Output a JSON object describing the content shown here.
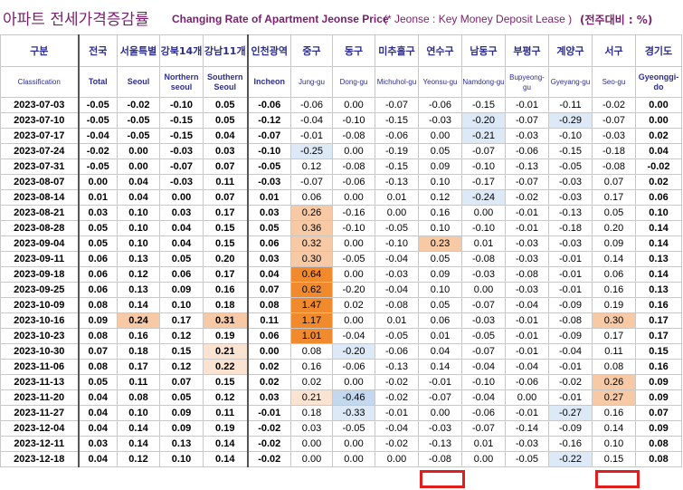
{
  "title": {
    "korean": "아파트 전세가격증감률",
    "english": "Changing Rate of Apartment Jeonse Price",
    "note": "(* Jeonse : Key Money Deposit Lease )",
    "unit": "(전주대비 : %)"
  },
  "headers": [
    {
      "kr": "구분",
      "en": "Classification"
    },
    {
      "kr": "전국",
      "en": "Total"
    },
    {
      "kr": "서울특별",
      "en": "Seoul"
    },
    {
      "kr": "강북14개",
      "en": "Northern seoul"
    },
    {
      "kr": "강남11개",
      "en": "Southern Seoul"
    },
    {
      "kr": "인천광역",
      "en": "Incheon"
    },
    {
      "kr": "중구",
      "en": "Jung-gu"
    },
    {
      "kr": "동구",
      "en": "Dong-gu"
    },
    {
      "kr": "미추홀구",
      "en": "Michuhol-gu"
    },
    {
      "kr": "연수구",
      "en": "Yeonsu-gu"
    },
    {
      "kr": "남동구",
      "en": "Namdong-gu"
    },
    {
      "kr": "부평구",
      "en": "Bupyeong-gu"
    },
    {
      "kr": "계양구",
      "en": "Gyeyang-gu"
    },
    {
      "kr": "서구",
      "en": "Seo-gu"
    },
    {
      "kr": "경기도",
      "en": "Gyeonggi-do"
    }
  ],
  "rows": [
    {
      "date": "2023-07-03",
      "values": [
        "-0.05",
        "-0.02",
        "-0.10",
        "0.05",
        "-0.06",
        "-0.06",
        "0.00",
        "-0.07",
        "-0.06",
        "-0.15",
        "-0.01",
        "-0.11",
        "-0.02",
        "0.00"
      ],
      "shade": {}
    },
    {
      "date": "2023-07-10",
      "values": [
        "-0.05",
        "-0.05",
        "-0.15",
        "0.05",
        "-0.12",
        "-0.04",
        "-0.10",
        "-0.15",
        "-0.03",
        "-0.20",
        "-0.07",
        "-0.29",
        "-0.07",
        "0.00"
      ],
      "shade": {
        "9": "b1",
        "11": "b1"
      }
    },
    {
      "date": "2023-07-17",
      "values": [
        "-0.04",
        "-0.05",
        "-0.15",
        "0.04",
        "-0.07",
        "-0.01",
        "-0.08",
        "-0.06",
        "0.00",
        "-0.21",
        "-0.03",
        "-0.10",
        "-0.03",
        "0.02"
      ],
      "shade": {
        "9": "b1"
      }
    },
    {
      "date": "2023-07-24",
      "values": [
        "-0.02",
        "0.00",
        "-0.03",
        "0.03",
        "-0.10",
        "-0.25",
        "0.00",
        "-0.19",
        "0.05",
        "-0.07",
        "-0.06",
        "-0.15",
        "-0.18",
        "0.04"
      ],
      "shade": {
        "5": "b1"
      }
    },
    {
      "date": "2023-07-31",
      "values": [
        "-0.05",
        "0.00",
        "-0.07",
        "0.07",
        "-0.05",
        "0.12",
        "-0.08",
        "-0.15",
        "0.09",
        "-0.10",
        "-0.13",
        "-0.05",
        "-0.08",
        "-0.02"
      ],
      "shade": {}
    },
    {
      "date": "2023-08-07",
      "values": [
        "0.00",
        "0.04",
        "-0.03",
        "0.11",
        "-0.03",
        "-0.07",
        "-0.06",
        "-0.13",
        "0.10",
        "-0.17",
        "-0.07",
        "-0.03",
        "0.07",
        "0.02"
      ],
      "shade": {}
    },
    {
      "date": "2023-08-14",
      "values": [
        "0.01",
        "0.04",
        "0.00",
        "0.07",
        "0.01",
        "0.06",
        "0.00",
        "0.01",
        "0.12",
        "-0.24",
        "-0.02",
        "-0.03",
        "0.17",
        "0.06"
      ],
      "shade": {
        "9": "b1"
      }
    },
    {
      "date": "2023-08-21",
      "values": [
        "0.03",
        "0.10",
        "0.03",
        "0.17",
        "0.03",
        "0.26",
        "-0.16",
        "0.00",
        "0.16",
        "0.00",
        "-0.01",
        "-0.13",
        "0.05",
        "0.10"
      ],
      "shade": {
        "5": "o2"
      }
    },
    {
      "date": "2023-08-28",
      "values": [
        "0.05",
        "0.10",
        "0.04",
        "0.15",
        "0.05",
        "0.36",
        "-0.10",
        "-0.05",
        "0.10",
        "-0.10",
        "-0.01",
        "-0.18",
        "0.20",
        "0.14"
      ],
      "shade": {
        "5": "o2"
      }
    },
    {
      "date": "2023-09-04",
      "values": [
        "0.05",
        "0.10",
        "0.04",
        "0.15",
        "0.06",
        "0.32",
        "0.00",
        "-0.10",
        "0.23",
        "0.01",
        "-0.03",
        "-0.03",
        "0.09",
        "0.14"
      ],
      "shade": {
        "5": "o2",
        "8": "o2"
      }
    },
    {
      "date": "2023-09-11",
      "values": [
        "0.06",
        "0.13",
        "0.05",
        "0.20",
        "0.03",
        "0.30",
        "-0.05",
        "-0.04",
        "0.05",
        "-0.08",
        "-0.03",
        "-0.01",
        "0.14",
        "0.13"
      ],
      "shade": {
        "5": "o2"
      }
    },
    {
      "date": "2023-09-18",
      "values": [
        "0.06",
        "0.12",
        "0.06",
        "0.17",
        "0.04",
        "0.64",
        "0.00",
        "-0.03",
        "0.09",
        "-0.03",
        "-0.08",
        "-0.01",
        "0.06",
        "0.14"
      ],
      "shade": {
        "5": "o4"
      }
    },
    {
      "date": "2023-09-25",
      "values": [
        "0.06",
        "0.13",
        "0.09",
        "0.16",
        "0.07",
        "0.62",
        "-0.20",
        "-0.04",
        "0.10",
        "0.00",
        "-0.03",
        "-0.01",
        "0.16",
        "0.13"
      ],
      "shade": {
        "5": "o4"
      }
    },
    {
      "date": "2023-10-09",
      "values": [
        "0.08",
        "0.14",
        "0.10",
        "0.18",
        "0.08",
        "1.47",
        "0.02",
        "-0.08",
        "0.05",
        "-0.07",
        "-0.04",
        "-0.09",
        "0.19",
        "0.16"
      ],
      "shade": {
        "5": "o4"
      }
    },
    {
      "date": "2023-10-16",
      "values": [
        "0.09",
        "0.24",
        "0.17",
        "0.31",
        "0.11",
        "1.17",
        "0.00",
        "0.01",
        "0.06",
        "-0.03",
        "-0.01",
        "-0.08",
        "0.30",
        "0.17"
      ],
      "shade": {
        "1": "o2",
        "3": "o2",
        "5": "o4",
        "12": "o2"
      }
    },
    {
      "date": "2023-10-23",
      "values": [
        "0.08",
        "0.16",
        "0.12",
        "0.19",
        "0.06",
        "1.01",
        "-0.04",
        "-0.05",
        "0.01",
        "-0.05",
        "-0.01",
        "-0.09",
        "0.17",
        "0.17"
      ],
      "shade": {
        "5": "o4"
      }
    },
    {
      "date": "2023-10-30",
      "values": [
        "0.07",
        "0.18",
        "0.15",
        "0.21",
        "0.00",
        "0.08",
        "-0.20",
        "-0.06",
        "0.04",
        "-0.07",
        "-0.01",
        "-0.04",
        "0.11",
        "0.15"
      ],
      "shade": {
        "3": "o1",
        "6": "b1"
      }
    },
    {
      "date": "2023-11-06",
      "values": [
        "0.08",
        "0.17",
        "0.12",
        "0.22",
        "0.02",
        "0.16",
        "-0.06",
        "-0.13",
        "0.14",
        "-0.04",
        "-0.04",
        "-0.01",
        "0.08",
        "0.16"
      ],
      "shade": {
        "3": "o1"
      }
    },
    {
      "date": "2023-11-13",
      "values": [
        "0.05",
        "0.11",
        "0.07",
        "0.15",
        "0.02",
        "0.02",
        "0.00",
        "-0.02",
        "-0.01",
        "-0.10",
        "-0.06",
        "-0.02",
        "0.26",
        "0.09"
      ],
      "shade": {
        "12": "o2"
      }
    },
    {
      "date": "2023-11-20",
      "values": [
        "0.04",
        "0.08",
        "0.05",
        "0.12",
        "0.03",
        "0.21",
        "-0.46",
        "-0.02",
        "-0.07",
        "-0.04",
        "0.00",
        "-0.01",
        "0.27",
        "0.09"
      ],
      "shade": {
        "5": "o1",
        "6": "b2",
        "12": "o2"
      }
    },
    {
      "date": "2023-11-27",
      "values": [
        "0.04",
        "0.10",
        "0.09",
        "0.11",
        "-0.01",
        "0.18",
        "-0.33",
        "-0.01",
        "0.00",
        "-0.06",
        "-0.01",
        "-0.27",
        "0.16",
        "0.07"
      ],
      "shade": {
        "6": "b1",
        "11": "b1"
      }
    },
    {
      "date": "2023-12-04",
      "values": [
        "0.04",
        "0.14",
        "0.09",
        "0.19",
        "-0.02",
        "0.03",
        "-0.05",
        "-0.04",
        "-0.03",
        "-0.07",
        "-0.14",
        "-0.09",
        "0.14",
        "0.09"
      ],
      "shade": {}
    },
    {
      "date": "2023-12-11",
      "values": [
        "0.03",
        "0.14",
        "0.13",
        "0.14",
        "-0.02",
        "0.00",
        "0.00",
        "-0.02",
        "-0.13",
        "0.01",
        "-0.03",
        "-0.16",
        "0.10",
        "0.08"
      ],
      "shade": {}
    },
    {
      "date": "2023-12-18",
      "values": [
        "0.04",
        "0.12",
        "0.10",
        "0.14",
        "-0.02",
        "0.00",
        "0.00",
        "0.00",
        "-0.08",
        "0.00",
        "-0.05",
        "-0.22",
        "0.15",
        "0.08"
      ],
      "shade": {
        "11": "b1"
      }
    }
  ]
}
